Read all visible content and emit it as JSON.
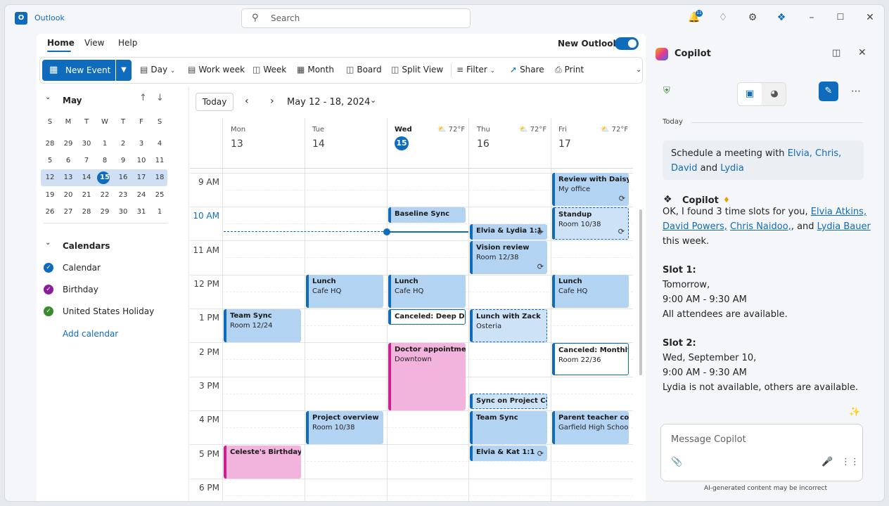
{
  "app": {
    "title": "Outlook",
    "search_placeholder": "Search",
    "notif_count": "11"
  },
  "tabs": [
    "Home",
    "View",
    "Help"
  ],
  "new_outlook_label": "New Outlook",
  "ribbon": {
    "new_event": "New Event",
    "day": "Day",
    "work_week": "Work week",
    "week": "Week",
    "month": "Month",
    "board": "Board",
    "split_view": "Split View",
    "filter": "Filter",
    "share": "Share",
    "print": "Print"
  },
  "mini_calendar": {
    "month": "May",
    "weekdays": [
      "S",
      "M",
      "T",
      "W",
      "T",
      "F",
      "S"
    ],
    "weeks": [
      [
        "28",
        "29",
        "30",
        "1",
        "2",
        "3",
        "4"
      ],
      [
        "5",
        "6",
        "7",
        "8",
        "9",
        "10",
        "11"
      ],
      [
        "12",
        "13",
        "14",
        "15",
        "16",
        "17",
        "18"
      ],
      [
        "19",
        "20",
        "21",
        "22",
        "23",
        "24",
        "25"
      ],
      [
        "26",
        "27",
        "28",
        "29",
        "30",
        "31",
        "1"
      ]
    ]
  },
  "calendars": {
    "heading": "Calendars",
    "items": [
      {
        "label": "Calendar",
        "color": "#0f6cbd"
      },
      {
        "label": "Birthday",
        "color": "#8a1e9c"
      },
      {
        "label": "United States Holiday",
        "color": "#3a8a2e"
      }
    ],
    "add": "Add calendar"
  },
  "nav": {
    "today": "Today",
    "range": "May 12 - 18, 2024"
  },
  "days": [
    {
      "name": "Mon",
      "num": "13",
      "weather": ""
    },
    {
      "name": "Tue",
      "num": "14",
      "weather": ""
    },
    {
      "name": "Wed",
      "num": "15",
      "weather": "72°F"
    },
    {
      "name": "Thu",
      "num": "16",
      "weather": "72°F"
    },
    {
      "name": "Fri",
      "num": "17",
      "weather": "72°F"
    }
  ],
  "times": [
    "9 AM",
    "10 AM",
    "11 AM",
    "12 PM",
    "1 PM",
    "2 PM",
    "3 PM",
    "4 PM",
    "5 PM",
    "6 PM"
  ],
  "events": [
    {
      "id": "fri-daisy",
      "title": "Review with Daisy",
      "loc": "My office"
    },
    {
      "id": "wed-baseline",
      "title": "Baseline Sync",
      "loc": ""
    },
    {
      "id": "fri-standup",
      "title": "Standup",
      "loc": "Room 10/38"
    },
    {
      "id": "thu-elvia-lydia",
      "title": "Elvia & Lydia 1:1",
      "loc": ""
    },
    {
      "id": "thu-vision",
      "title": "Vision review",
      "loc": "Room 12/38"
    },
    {
      "id": "tue-lunch",
      "title": "Lunch",
      "loc": "Cafe HQ"
    },
    {
      "id": "wed-lunch",
      "title": "Lunch",
      "loc": "Cafe HQ"
    },
    {
      "id": "fri-lunch",
      "title": "Lunch",
      "loc": "Cafe HQ"
    },
    {
      "id": "mon-teamsync",
      "title": "Team Sync",
      "loc": "Room 12/24"
    },
    {
      "id": "wed-deepdive",
      "title": "Canceled: Deep Dive",
      "loc": ""
    },
    {
      "id": "thu-zack",
      "title": "Lunch with Zack",
      "loc": "Osteria"
    },
    {
      "id": "wed-doctor",
      "title": "Doctor appointment",
      "loc": "Downtown"
    },
    {
      "id": "fri-monthly",
      "title": "Canceled: Monthly Team",
      "loc": "Room 22/36"
    },
    {
      "id": "thu-projcora",
      "title": "Sync on Project Cora",
      "loc": ""
    },
    {
      "id": "tue-projover",
      "title": "Project overview",
      "loc": "Room 10/38"
    },
    {
      "id": "thu-teamsync",
      "title": "Team Sync",
      "loc": ""
    },
    {
      "id": "fri-parent",
      "title": "Parent teacher conference",
      "loc": "Garfield High School"
    },
    {
      "id": "mon-celeste",
      "title": "Celeste's Birthday Party",
      "loc": ""
    },
    {
      "id": "thu-elvia-kat",
      "title": "Elvia & Kat 1:1",
      "loc": ""
    }
  ],
  "copilot": {
    "title": "Copilot",
    "date_label": "Today",
    "user_msg_pre": "Schedule a meeting with ",
    "user_msg_names": "Elvia, Chris, David",
    "user_msg_and": " and ",
    "user_msg_last": "Lydia",
    "bot_name": "Copilot",
    "reply_pre": "OK, I found 3 time slots for you, ",
    "people": [
      "Elvia Atkins,",
      "David Powers,",
      "Chris Naidoo,",
      "Lydia Bauer"
    ],
    "reply_and": ", and ",
    "reply_post": "this week.",
    "slot1_title": "Slot 1:",
    "slot1_l1": "Tomorrow,",
    "slot1_l2": "9:00 AM - 9:30 AM",
    "slot1_l3": "All attendees are available.",
    "slot2_title": "Slot 2:",
    "slot2_l1": "Wed, September 10,",
    "slot2_l2": "9:00 AM - 9:30 AM",
    "slot2_l3": "Lydia is not available, others are available.",
    "input_placeholder": "Message Copilot",
    "disclaimer": "AI-generated content may be incorrect"
  }
}
